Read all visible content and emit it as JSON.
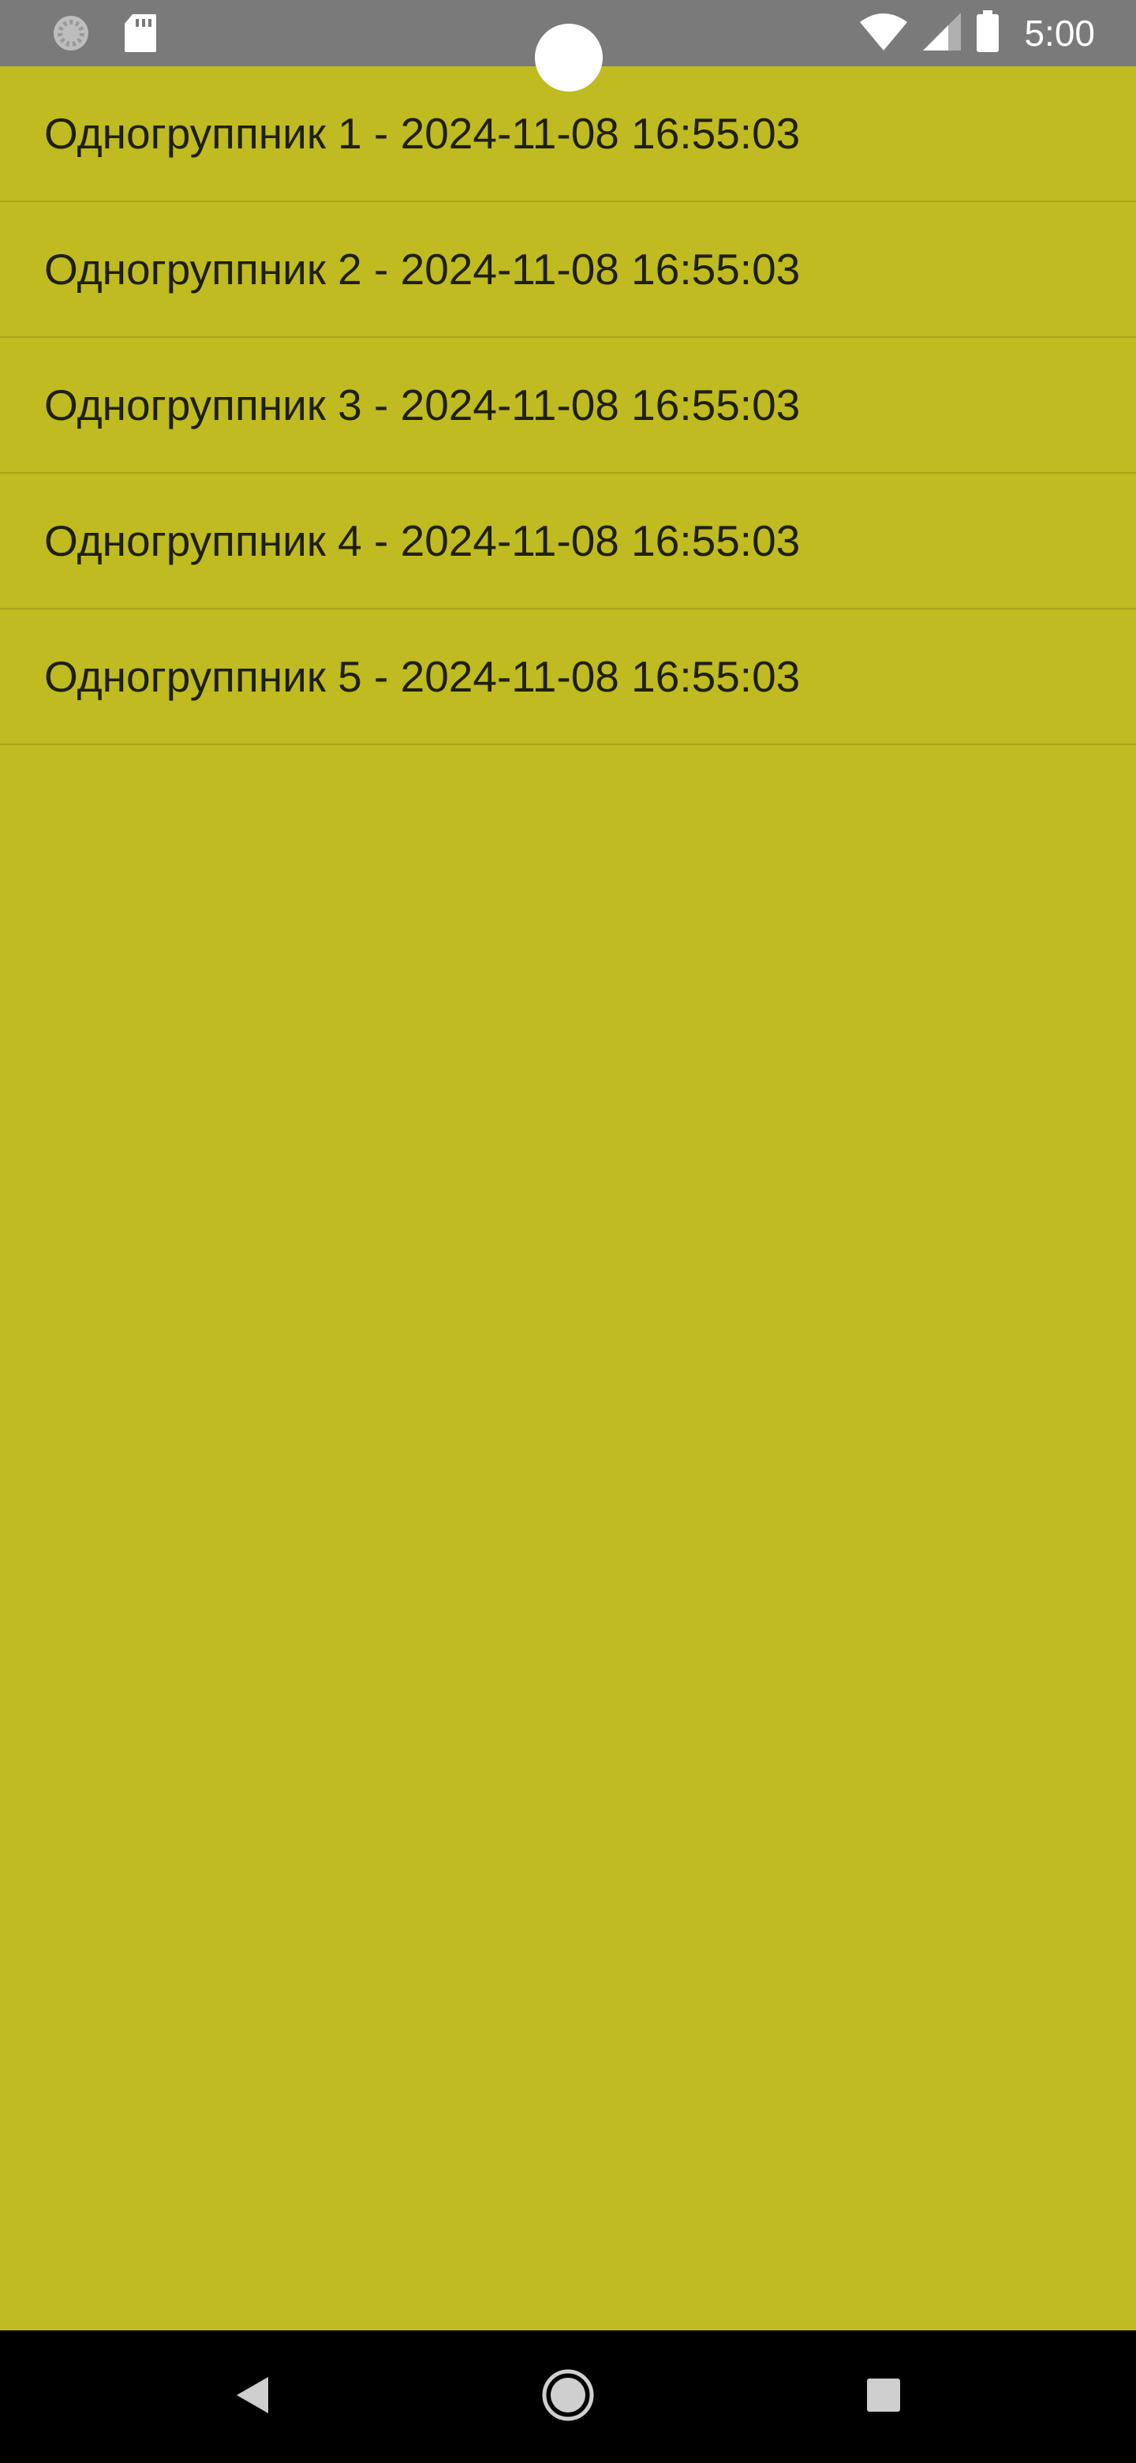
{
  "status_bar": {
    "time": "5:00",
    "icons": [
      "loading-icon",
      "sd-card-icon",
      "wifi-icon",
      "cell-signal-icon",
      "battery-icon"
    ]
  },
  "list": {
    "items": [
      {
        "label": "Одногруппник 1 - 2024-11-08 16:55:03"
      },
      {
        "label": "Одногруппник 2 - 2024-11-08 16:55:03"
      },
      {
        "label": "Одногруппник 3 - 2024-11-08 16:55:03"
      },
      {
        "label": "Одногруппник 4 - 2024-11-08 16:55:03"
      },
      {
        "label": "Одногруппник 5 - 2024-11-08 16:55:03"
      }
    ]
  },
  "nav_bar": {
    "icons": [
      "back-icon",
      "home-icon",
      "recents-icon"
    ]
  },
  "colors": {
    "background": "#bfbb20",
    "status_bar": "#7a7a7a",
    "nav_bar": "#000000",
    "divider": "#a8a41b",
    "text": "#1f1f10"
  }
}
